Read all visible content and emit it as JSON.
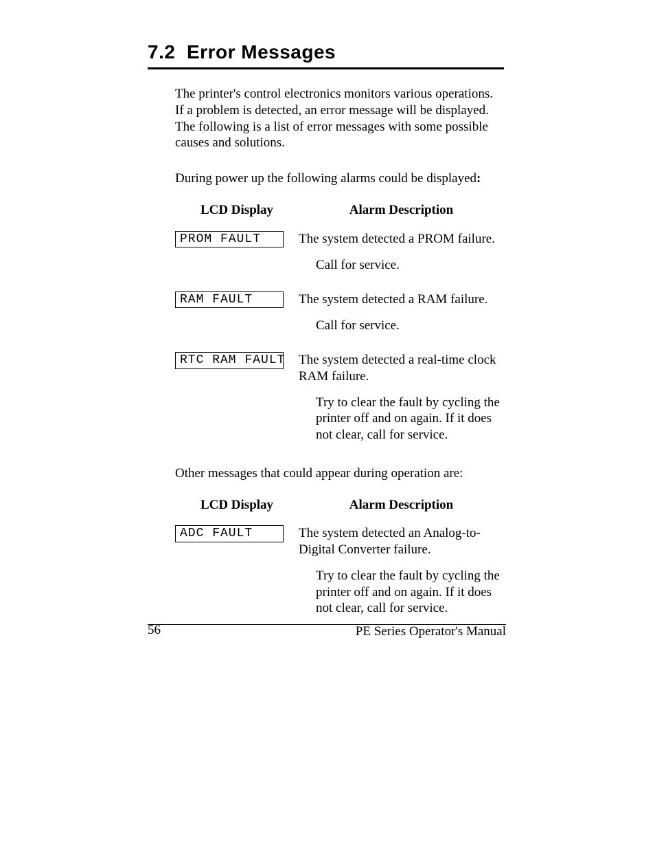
{
  "section_number": "7.2",
  "section_title": "Error Messages",
  "intro_paragraph": "The printer's control electronics monitors various operations.  If a problem is detected, an error message will be displayed.  The following is a list of error messages with some possible causes and solutions.",
  "powerup_intro": "During power up the following alarms could be displayed",
  "headers": {
    "lcd": "LCD Display",
    "alarm": "Alarm Description"
  },
  "powerup_rows": [
    {
      "lcd": "PROM FAULT",
      "desc": "The system detected a PROM failure.",
      "sub": "Call for service."
    },
    {
      "lcd": "RAM FAULT",
      "desc": "The system detected a RAM failure.",
      "sub": "Call for service."
    },
    {
      "lcd": "RTC RAM FAULT",
      "desc": "The system detected a real-time clock RAM failure.",
      "sub": "Try to clear the fault by cycling the printer off and on again.  If it does not clear, call for service."
    }
  ],
  "operation_intro": "Other messages that could appear during operation are:",
  "operation_rows": [
    {
      "lcd": "ADC FAULT",
      "desc": "The system detected an Analog-to-Digital Converter failure.",
      "sub": "Try to clear the fault by cycling the printer off and on again.  If it does not clear, call for service."
    }
  ],
  "footer": {
    "page_number": "56",
    "manual_name": "PE Series Operator's Manual"
  }
}
